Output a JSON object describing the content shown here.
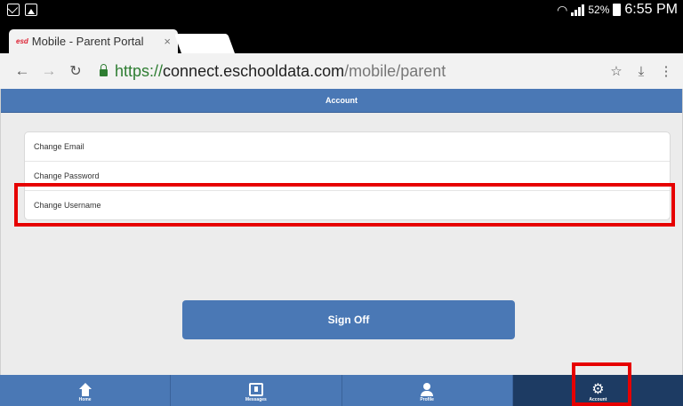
{
  "status_bar": {
    "battery": "52%",
    "time": "6:55 PM"
  },
  "browser": {
    "tab_title": "Mobile - Parent Portal",
    "tab_favicon": "esd",
    "tab_close": "×",
    "url_scheme": "https://",
    "url_host": "connect.eschooldata.com",
    "url_path": "/mobile/parent",
    "icons": [
      "back-arrow-icon",
      "forward-arrow-icon",
      "reload-icon",
      "lock-icon",
      "star-icon",
      "download-icon",
      "more-vertical-icon"
    ]
  },
  "page": {
    "header_title": "Account",
    "settings_items": [
      {
        "label": "Change Email"
      },
      {
        "label": "Change Password"
      },
      {
        "label": "Change Username"
      }
    ],
    "signoff_label": "Sign Off"
  },
  "bottom_nav": {
    "items": [
      {
        "label": "Home",
        "icon": "home-icon"
      },
      {
        "label": "Messages",
        "icon": "inbox-icon"
      },
      {
        "label": "Profile",
        "icon": "user-icon"
      },
      {
        "label": "Account",
        "icon": "gears-icon",
        "active": true
      }
    ]
  },
  "colors": {
    "accent": "#4a78b5",
    "active_tab": "#1d3b63",
    "highlight": "#e60000",
    "secure_green": "#2e7d32"
  }
}
